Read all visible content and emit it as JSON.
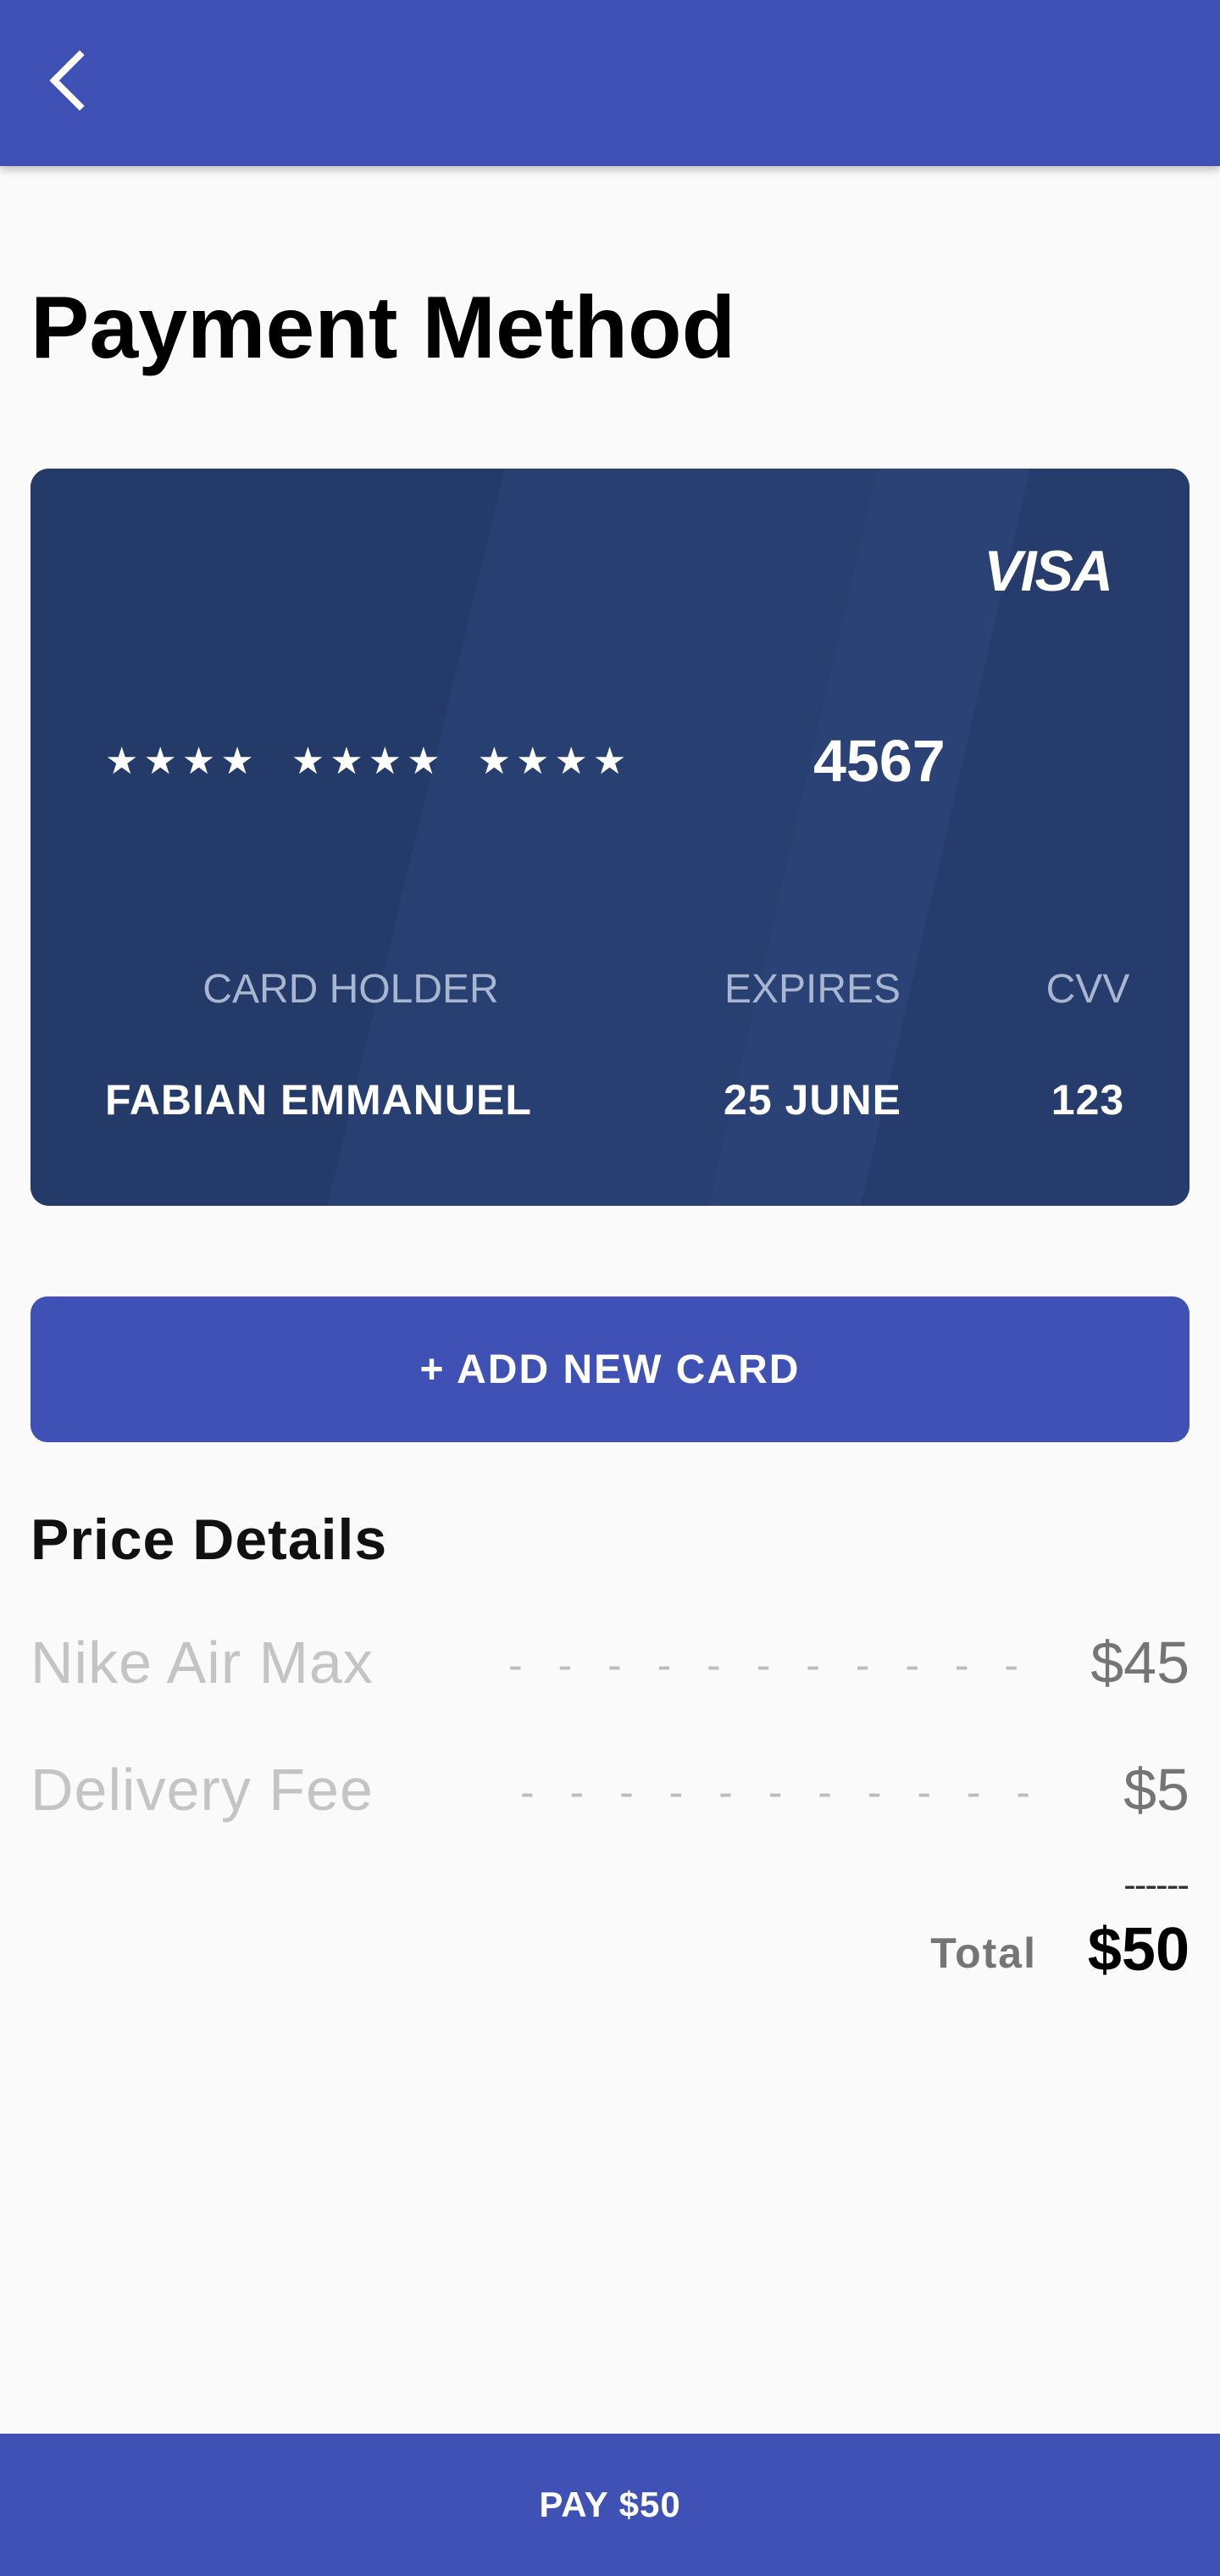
{
  "app_bar": {
    "back_icon": "chevron-left-icon",
    "background_color": "#3f51b5"
  },
  "page": {
    "title": "Payment Method"
  },
  "card": {
    "brand": "VISA",
    "masked_groups": [
      "★★★★",
      "★★★★",
      "★★★★"
    ],
    "last_four": "4567",
    "holder_label": "CARD HOLDER",
    "holder_value": "FABIAN EMMANUEL",
    "expires_label": "EXPIRES",
    "expires_value": "25 JUNE",
    "cvv_label": "CVV",
    "cvv_value": "123",
    "background_color": "#263d6e"
  },
  "add_card": {
    "label": "+ ADD NEW CARD"
  },
  "price_details": {
    "title": "Price Details",
    "items": [
      {
        "label": "Nike Air Max",
        "dashes": "- - - - - - - - - - -",
        "value": "$45"
      },
      {
        "label": "Delivery Fee",
        "dashes": "- - - - - - - - - - -",
        "value": "$5"
      }
    ],
    "sum_line": "------",
    "total_label": "Total",
    "total_value": "$50"
  },
  "pay_button": {
    "label": "PAY $50"
  }
}
